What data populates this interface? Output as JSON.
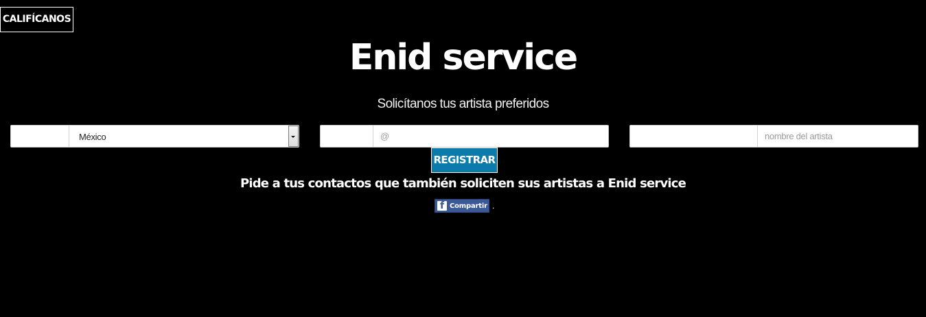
{
  "header": {
    "rate_button_label": "CALIFÍCANOS"
  },
  "main": {
    "title": "Enid service",
    "subtitle": "Solicítanos tus artista preferidos"
  },
  "form": {
    "country": {
      "selected": "México"
    },
    "email": {
      "value": "",
      "placeholder": "@"
    },
    "artist": {
      "value": "",
      "placeholder": "nombre del artista"
    },
    "register_label": "REGISTRAR"
  },
  "invite": {
    "text": "Pide a tus contactos que también soliciten sus artistas a Enid service",
    "share_label": "Compartir",
    "trailing_text": "."
  },
  "colors": {
    "background": "#000000",
    "text": "#ffffff",
    "accent": "#0b7bab",
    "facebook": "#3b5998"
  },
  "icons": {
    "share": "facebook-icon",
    "select": "chevron-down-icon"
  }
}
